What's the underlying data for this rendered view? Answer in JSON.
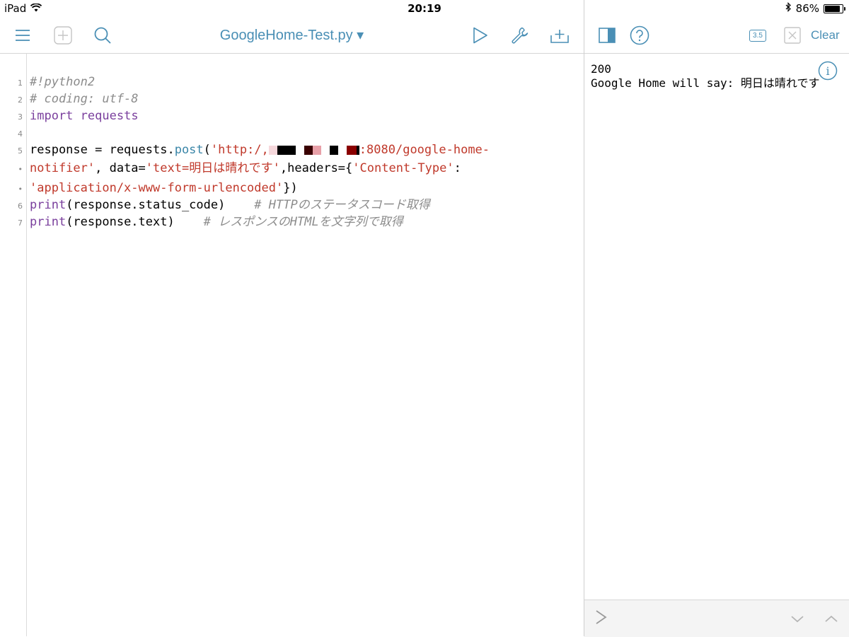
{
  "status_bar": {
    "device": "iPad",
    "time": "20:19",
    "battery_percent": "86%",
    "battery_level": 0.86
  },
  "editor": {
    "file_title": "GoogleHome-Test.py ▾",
    "lines": [
      {
        "num": "1",
        "tokens": [
          {
            "t": "#!python2",
            "c": "cm"
          }
        ]
      },
      {
        "num": "2",
        "tokens": [
          {
            "t": "# coding: utf-8",
            "c": "cm"
          }
        ]
      },
      {
        "num": "3",
        "tokens": [
          {
            "t": "import",
            "c": "kw"
          },
          {
            "t": " ",
            "c": ""
          },
          {
            "t": "requests",
            "c": "kw"
          }
        ]
      },
      {
        "num": "4",
        "tokens": []
      },
      {
        "num": "5",
        "tokens": [
          {
            "t": "response = requests.",
            "c": ""
          },
          {
            "t": "post",
            "c": "fn"
          },
          {
            "t": "(",
            "c": ""
          },
          {
            "t": "'http:/,",
            "c": "str"
          },
          {
            "t": "REDACTED",
            "c": "redact"
          },
          {
            "t": ":8080/google-home-",
            "c": "str"
          }
        ]
      },
      {
        "num": "•",
        "tokens": [
          {
            "t": "notifier'",
            "c": "str"
          },
          {
            "t": ", data=",
            "c": ""
          },
          {
            "t": "'text=明日は晴れです'",
            "c": "str"
          },
          {
            "t": ",headers={",
            "c": ""
          },
          {
            "t": "'Content-Type'",
            "c": "str"
          },
          {
            "t": ":",
            "c": ""
          }
        ]
      },
      {
        "num": "•",
        "tokens": [
          {
            "t": "'application/x-www-form-urlencoded'",
            "c": "str"
          },
          {
            "t": "})",
            "c": ""
          }
        ]
      },
      {
        "num": "6",
        "tokens": [
          {
            "t": "print",
            "c": "kw"
          },
          {
            "t": "(response.status_code)    ",
            "c": ""
          },
          {
            "t": "# HTTPのステータスコード取得",
            "c": "cm"
          }
        ]
      },
      {
        "num": "7",
        "tokens": [
          {
            "t": "print",
            "c": "kw"
          },
          {
            "t": "(response.text)    ",
            "c": ""
          },
          {
            "t": "# レスポンスのHTMLを文字列で取得",
            "c": "cm"
          }
        ]
      }
    ]
  },
  "console": {
    "version_badge": "3.5",
    "clear_label": "Clear",
    "output": "200\nGoogle Home will say: 明日は晴れです"
  },
  "icons": {
    "menu": "menu-icon",
    "new_file": "add-file-icon",
    "search": "search-icon",
    "run": "play-icon",
    "tools": "wrench-icon",
    "share": "share-icon",
    "panel": "panel-toggle-icon",
    "help": "help-icon",
    "info": "info-icon",
    "close": "close-icon",
    "prompt": "chevron-right-icon",
    "history_down": "chevron-down-icon",
    "history_up": "chevron-up-icon"
  },
  "colors": {
    "accent": "#4a8fb5",
    "keyword": "#7a3f9d",
    "function": "#3a86a8",
    "string": "#c0392b",
    "comment": "#8c8c8c"
  }
}
